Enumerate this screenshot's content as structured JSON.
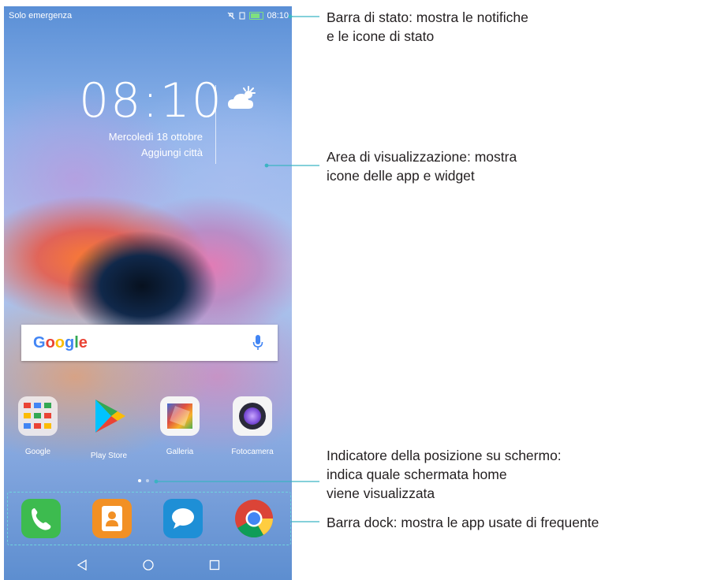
{
  "statusbar": {
    "carrier": "Solo emergenza",
    "time": "08:10",
    "icons": [
      "no-notifications-icon",
      "sim-icon",
      "battery-icon"
    ]
  },
  "clock_widget": {
    "time": "08:10",
    "date": "Mercoledì 18 ottobre",
    "city": "Aggiungi città",
    "weather_icon": "partly-cloudy-icon"
  },
  "search": {
    "brand": "Google",
    "mic_icon": "mic-icon"
  },
  "apps": [
    {
      "label": "Google",
      "icon": "google-folder-icon"
    },
    {
      "label": "Play Store",
      "icon": "play-store-icon"
    },
    {
      "label": "Galleria",
      "icon": "gallery-icon"
    },
    {
      "label": "Fotocamera",
      "icon": "camera-icon"
    }
  ],
  "page_indicator": {
    "total": 2,
    "current": 1
  },
  "dock": [
    {
      "icon": "phone-icon",
      "color": "#3dbb4f"
    },
    {
      "icon": "contacts-icon",
      "color": "#f29024"
    },
    {
      "icon": "messages-icon",
      "color": "#1e8fd6"
    },
    {
      "icon": "chrome-icon",
      "color": "#ffffff"
    }
  ],
  "navbar": [
    "back-icon",
    "home-icon",
    "recents-icon"
  ],
  "annotations": [
    {
      "id": "statusbar",
      "lines": [
        "Barra di stato: mostra le notifiche",
        "e le icone di stato"
      ]
    },
    {
      "id": "display",
      "lines": [
        "Area di visualizzazione: mostra",
        "icone delle app e widget"
      ]
    },
    {
      "id": "indicator",
      "lines": [
        "Indicatore della posizione su schermo:",
        "indica quale schermata home",
        "viene visualizzata"
      ]
    },
    {
      "id": "dock",
      "lines": [
        "Barra dock: mostra le app usate di frequente"
      ]
    }
  ],
  "colors": {
    "callout_line": "#3bb3c3",
    "text": "#231f20"
  }
}
